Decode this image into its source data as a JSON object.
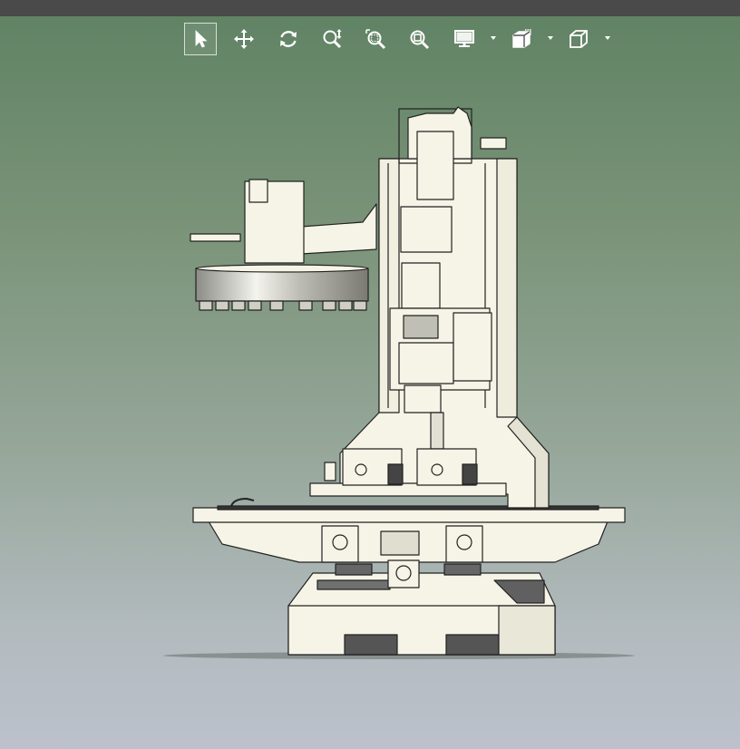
{
  "toolbar": {
    "tools": [
      {
        "id": "select",
        "icon": "select-arrow-icon",
        "active": true
      },
      {
        "id": "pan",
        "icon": "pan-move-icon",
        "active": false
      },
      {
        "id": "rotate",
        "icon": "rotate-icon",
        "active": false
      },
      {
        "id": "zoom",
        "icon": "zoom-icon",
        "active": false
      },
      {
        "id": "zoom-window",
        "icon": "zoom-window-icon",
        "active": false
      },
      {
        "id": "zoom-fit",
        "icon": "zoom-fit-icon",
        "active": false
      },
      {
        "id": "display",
        "icon": "display-monitor-icon",
        "dropdown": true
      },
      {
        "id": "shading",
        "icon": "shading-cube-icon",
        "dropdown": true
      },
      {
        "id": "view-orientation",
        "icon": "view-cube-icon",
        "dropdown": true
      }
    ]
  },
  "colors": {
    "topbar": "#4a4a4a",
    "model_body": "#f6f4e6",
    "model_outline": "#222222",
    "bg_top": "#5f8263",
    "bg_bottom": "#bcc1cc"
  },
  "viewport": {
    "model": "vertical-machining-center-3d-model"
  }
}
